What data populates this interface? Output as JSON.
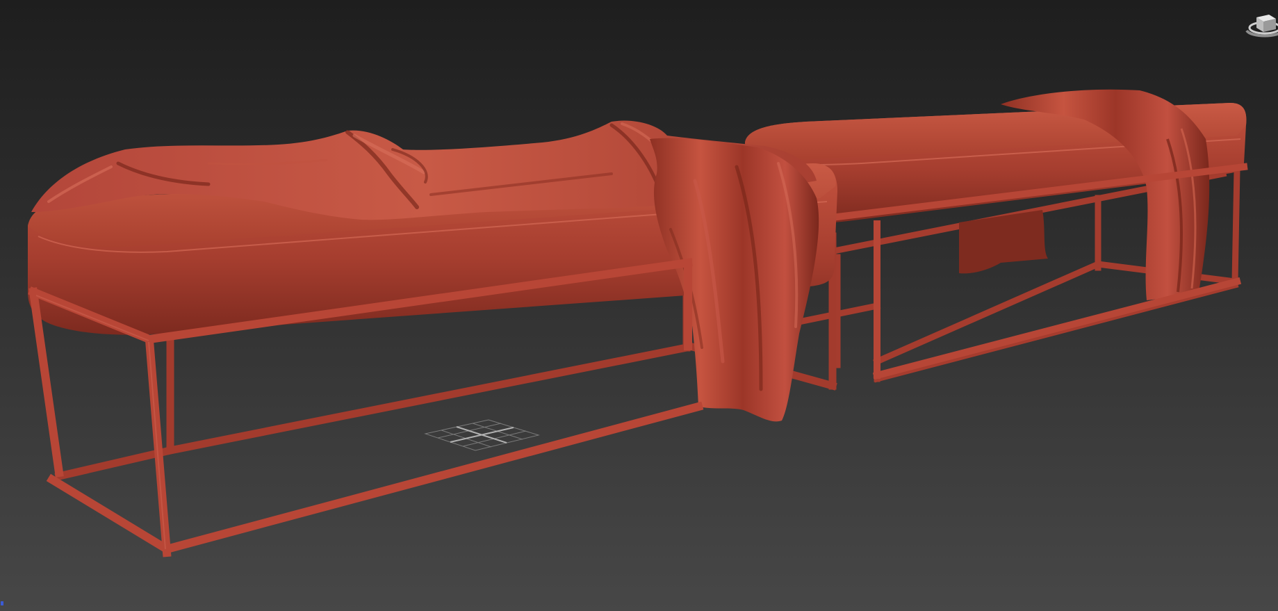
{
  "viewport": {
    "background_top": "#1e1e1e",
    "background_bottom": "#474747",
    "shading": "clay",
    "model_color": "#b94a3c",
    "model_shadow": "#6e2519",
    "model_highlight": "#d8705c"
  },
  "objects": [
    {
      "name": "bench-left",
      "parts": [
        "cushion",
        "metal-frame",
        "draped-throw"
      ]
    },
    {
      "name": "bench-right",
      "parts": [
        "cushion",
        "metal-frame",
        "draped-throw"
      ]
    }
  ],
  "widgets": {
    "viewcube": "viewcube-icon",
    "ground_grid": "grid-icon",
    "corner_marker": "axis-marker-icon"
  }
}
